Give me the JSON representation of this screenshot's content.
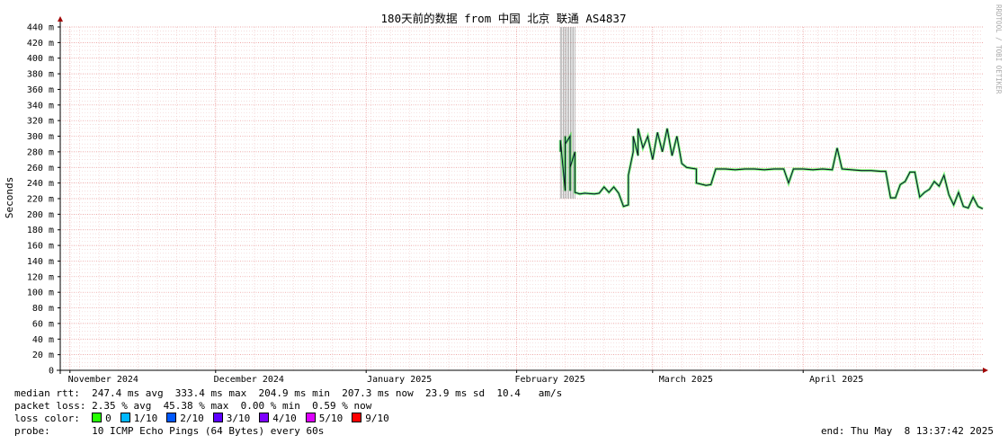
{
  "chart_data": {
    "type": "line",
    "title": "180天前的数据 from 中国 北京 联通 AS4837",
    "ylabel": "Seconds",
    "ylim": [
      0,
      440
    ],
    "y_ticks": [
      "0",
      "20 m",
      "40 m",
      "60 m",
      "80 m",
      "100 m",
      "120 m",
      "140 m",
      "160 m",
      "180 m",
      "200 m",
      "220 m",
      "240 m",
      "260 m",
      "280 m",
      "300 m",
      "320 m",
      "340 m",
      "360 m",
      "380 m",
      "400 m",
      "420 m",
      "440 m"
    ],
    "x_range": [
      "2024-10-30",
      "2025-05-08"
    ],
    "x_ticks": [
      {
        "label": "November 2024",
        "date": "2024-11-01"
      },
      {
        "label": "December 2024",
        "date": "2024-12-01"
      },
      {
        "label": "January 2025",
        "date": "2025-01-01"
      },
      {
        "label": "February 2025",
        "date": "2025-02-01"
      },
      {
        "label": "March 2025",
        "date": "2025-03-01"
      },
      {
        "label": "April 2025",
        "date": "2025-04-01"
      }
    ],
    "grid": true,
    "watermark": "RRDTOOL / TOBI OETIKER",
    "series": [
      {
        "points": [
          [
            "2025-02-10",
            280
          ],
          [
            "2025-02-10",
            295
          ],
          [
            "2025-02-11",
            230
          ],
          [
            "2025-02-11",
            300
          ],
          [
            "2025-02-11",
            290
          ],
          [
            "2025-02-12",
            300
          ],
          [
            "2025-02-12",
            230
          ],
          [
            "2025-02-12",
            260
          ],
          [
            "2025-02-13",
            280
          ],
          [
            "2025-02-13",
            228
          ],
          [
            "2025-02-14",
            226
          ],
          [
            "2025-02-15",
            227
          ],
          [
            "2025-02-17",
            226
          ],
          [
            "2025-02-18",
            227
          ],
          [
            "2025-02-19",
            235
          ],
          [
            "2025-02-20",
            228
          ],
          [
            "2025-02-21",
            235
          ],
          [
            "2025-02-22",
            227
          ],
          [
            "2025-02-23",
            210
          ],
          [
            "2025-02-24",
            212
          ],
          [
            "2025-02-24",
            250
          ],
          [
            "2025-02-25",
            280
          ],
          [
            "2025-02-25",
            300
          ],
          [
            "2025-02-26",
            275
          ],
          [
            "2025-02-26",
            310
          ],
          [
            "2025-02-27",
            285
          ],
          [
            "2025-02-28",
            300
          ],
          [
            "2025-03-01",
            270
          ],
          [
            "2025-03-02",
            305
          ],
          [
            "2025-03-03",
            280
          ],
          [
            "2025-03-04",
            310
          ],
          [
            "2025-03-05",
            275
          ],
          [
            "2025-03-06",
            300
          ],
          [
            "2025-03-07",
            265
          ],
          [
            "2025-03-08",
            260
          ],
          [
            "2025-03-10",
            258
          ],
          [
            "2025-03-10",
            240
          ],
          [
            "2025-03-12",
            237
          ],
          [
            "2025-03-13",
            238
          ],
          [
            "2025-03-14",
            258
          ],
          [
            "2025-03-16",
            258
          ],
          [
            "2025-03-18",
            257
          ],
          [
            "2025-03-20",
            258
          ],
          [
            "2025-03-22",
            258
          ],
          [
            "2025-03-24",
            257
          ],
          [
            "2025-03-26",
            258
          ],
          [
            "2025-03-28",
            258
          ],
          [
            "2025-03-29",
            240
          ],
          [
            "2025-03-30",
            258
          ],
          [
            "2025-04-01",
            258
          ],
          [
            "2025-04-03",
            257
          ],
          [
            "2025-04-05",
            258
          ],
          [
            "2025-04-07",
            257
          ],
          [
            "2025-04-08",
            285
          ],
          [
            "2025-04-09",
            258
          ],
          [
            "2025-04-11",
            257
          ],
          [
            "2025-04-13",
            256
          ],
          [
            "2025-04-15",
            256
          ],
          [
            "2025-04-17",
            255
          ],
          [
            "2025-04-18",
            255
          ],
          [
            "2025-04-19",
            221
          ],
          [
            "2025-04-20",
            221
          ],
          [
            "2025-04-21",
            238
          ],
          [
            "2025-04-22",
            242
          ],
          [
            "2025-04-23",
            254
          ],
          [
            "2025-04-24",
            254
          ],
          [
            "2025-04-25",
            222
          ],
          [
            "2025-04-26",
            228
          ],
          [
            "2025-04-27",
            232
          ],
          [
            "2025-04-28",
            242
          ],
          [
            "2025-04-29",
            236
          ],
          [
            "2025-04-30",
            250
          ],
          [
            "2025-05-01",
            225
          ],
          [
            "2025-05-02",
            212
          ],
          [
            "2025-05-03",
            228
          ],
          [
            "2025-05-04",
            210
          ],
          [
            "2025-05-05",
            208
          ],
          [
            "2025-05-06",
            222
          ],
          [
            "2025-05-07",
            210
          ],
          [
            "2025-05-08",
            207
          ]
        ]
      }
    ],
    "loss_bands": [
      {
        "from": "2025-02-10",
        "to": "2025-02-13",
        "max": 440
      }
    ]
  },
  "stats": {
    "median_rtt": "median rtt:  247.4 ms avg  333.4 ms max  204.9 ms min  207.3 ms now  23.9 ms sd  10.4   am/s",
    "packet_loss": "packet loss: 2.35 % avg  45.38 % max  0.00 % min  0.59 % now",
    "loss_color_label": "loss color:",
    "loss_colors": [
      {
        "label": "0",
        "color": "#26ff00"
      },
      {
        "label": "1/10",
        "color": "#00b8ff"
      },
      {
        "label": "2/10",
        "color": "#0059ff"
      },
      {
        "label": "3/10",
        "color": "#5e00ff"
      },
      {
        "label": "4/10",
        "color": "#7e00ff"
      },
      {
        "label": "5/10",
        "color": "#dd00ff"
      },
      {
        "label": "9/10",
        "color": "#ff0000"
      }
    ],
    "probe": "probe:       10 ICMP Echo Pings (64 Bytes) every 60s",
    "end": "end: Thu May  8 13:37:42 2025"
  }
}
